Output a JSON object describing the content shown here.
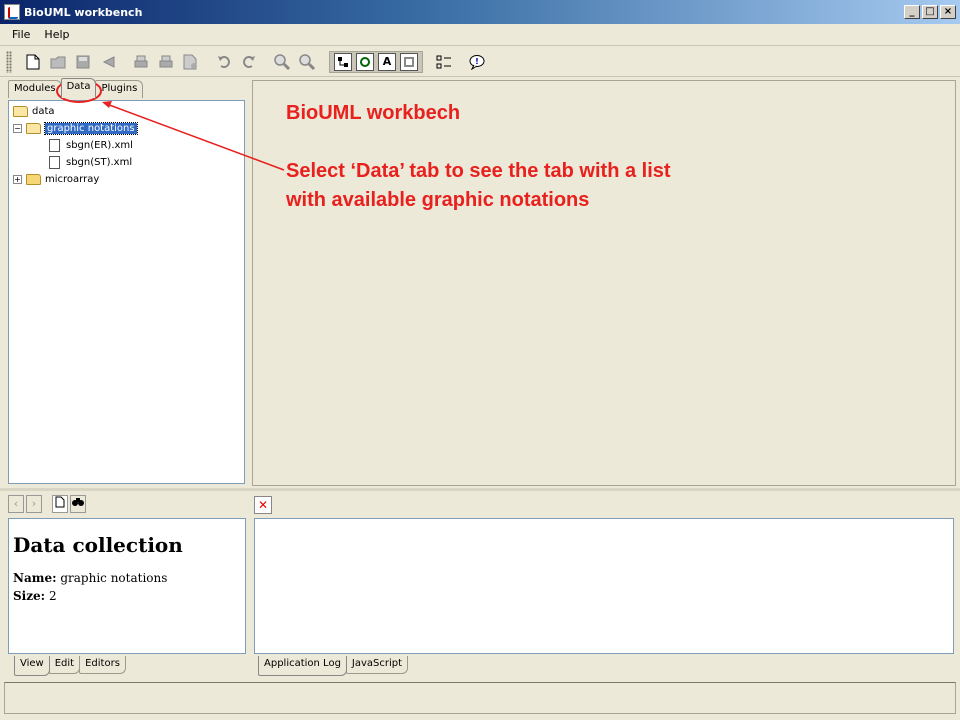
{
  "window": {
    "title": "BioUML workbench",
    "controls": [
      "_",
      "□",
      "×"
    ]
  },
  "menu": {
    "items": [
      "File",
      "Help"
    ]
  },
  "toolbar": {
    "buttons": [
      {
        "icon": "new-document-icon",
        "enabled": true
      },
      {
        "icon": "open-icon",
        "enabled": false
      },
      {
        "icon": "save-icon",
        "enabled": false
      },
      {
        "icon": "back-icon",
        "enabled": false
      },
      {
        "icon": "print-icon",
        "enabled": false
      },
      {
        "icon": "print-preview-icon",
        "enabled": false
      },
      {
        "icon": "export-icon",
        "enabled": false
      },
      {
        "icon": "undo-icon",
        "enabled": false
      },
      {
        "icon": "redo-icon",
        "enabled": false
      },
      {
        "icon": "zoom-in-icon",
        "enabled": false
      },
      {
        "icon": "zoom-out-icon",
        "enabled": false
      },
      {
        "icon": "select-mode-icon",
        "enabled": true
      },
      {
        "icon": "graph-mode-icon",
        "enabled": true
      },
      {
        "icon": "text-mode-icon",
        "label": "A",
        "enabled": true
      },
      {
        "icon": "pattern-mode-icon",
        "enabled": true
      },
      {
        "icon": "layout-icon",
        "enabled": true
      },
      {
        "icon": "info-icon",
        "enabled": true
      }
    ]
  },
  "repository": {
    "tabs": [
      "Modules",
      "Data",
      "Plugins"
    ],
    "active_tab": "Data",
    "tree": {
      "root": "data",
      "folder": "graphic notations",
      "files": [
        "sbgn(ER).xml",
        "sbgn(ST).xml"
      ],
      "other": "microarray"
    }
  },
  "annotation": {
    "title": "BioUML workbech",
    "line1": "Select ‘Data’ tab to see the tab with a list",
    "line2": "with available graphic notations",
    "color": "#e8201e"
  },
  "info_panel": {
    "title": "Data collection",
    "name_label": "Name:",
    "name_value": "graphic notations",
    "size_label": "Size:",
    "size_value": "2",
    "tabs": [
      "View",
      "Edit",
      "Editors"
    ]
  },
  "log_panel": {
    "tabs": [
      "Application Log",
      "JavaScript"
    ]
  }
}
